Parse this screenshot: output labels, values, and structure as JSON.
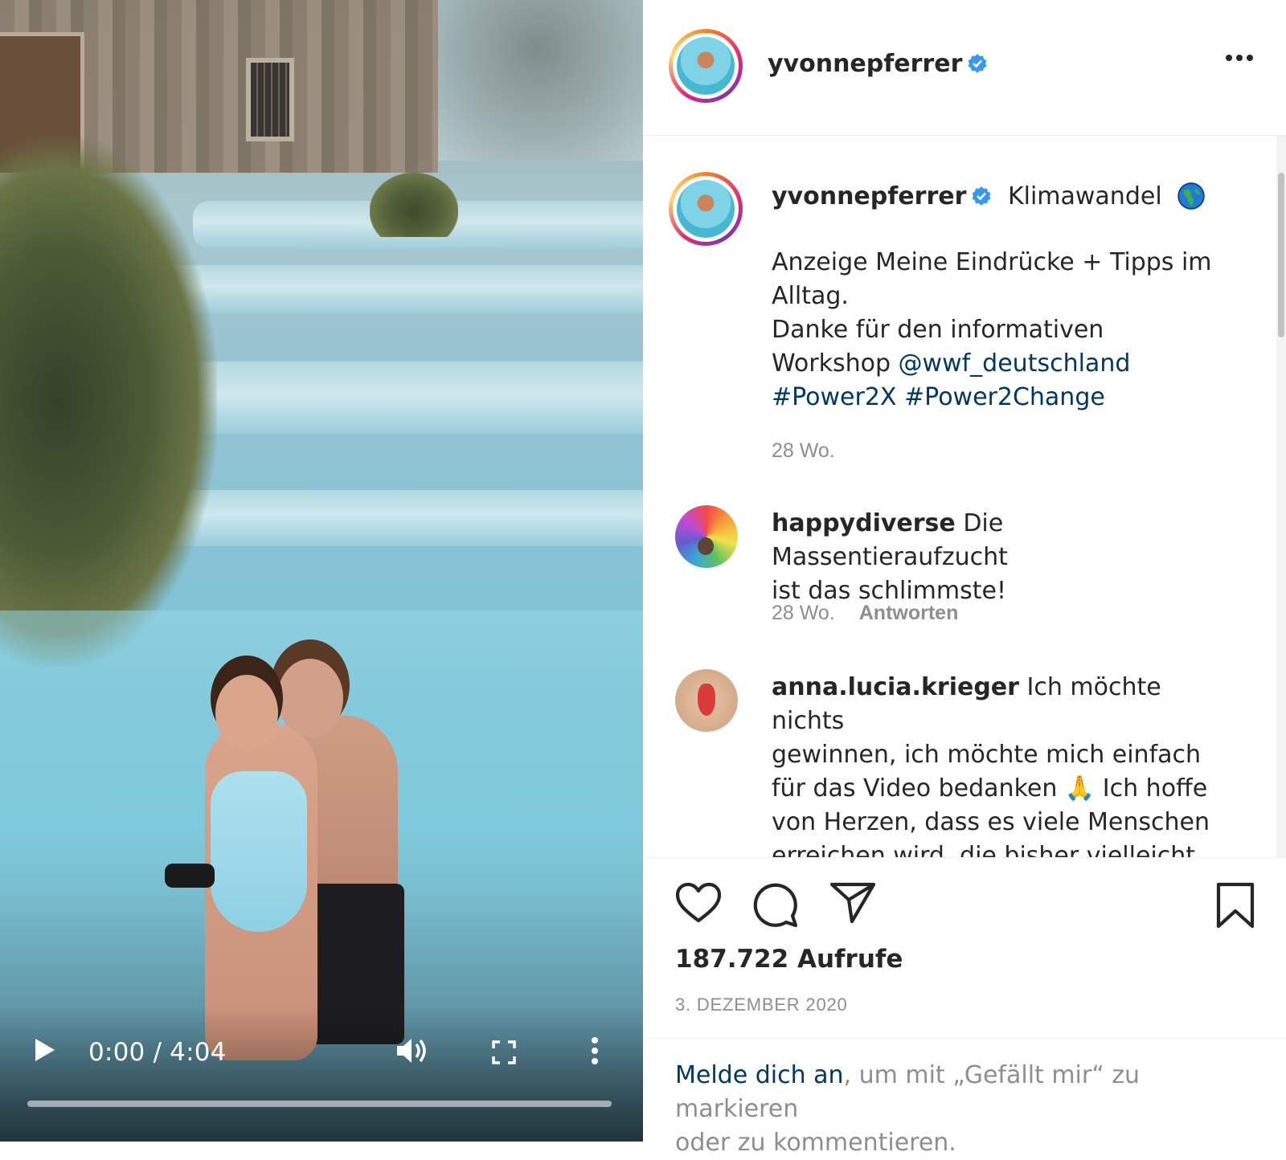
{
  "video": {
    "time_label": "0:00 / 4:04",
    "progress": 0
  },
  "header": {
    "username": "yvonnepferrer"
  },
  "caption": {
    "username": "yvonnepferrer",
    "title": "Klimawandel",
    "line1": "Anzeige Meine Eindrücke + Tipps im",
    "line2": "Alltag.",
    "line3": "Danke für den informativen",
    "line4_prefix": "Workshop ",
    "mention": "@wwf_deutschland",
    "hashtag1": "#Power2X",
    "hashtag2": "#Power2Change",
    "age": "28 Wo."
  },
  "comments": [
    {
      "username": "happydiverse",
      "text_line1": "Die Massentieraufzucht",
      "text_line2": "ist das schlimmste!",
      "age": "28 Wo.",
      "reply_label": "Antworten"
    },
    {
      "username": "anna.lucia.krieger",
      "text_line1": "Ich möchte nichts",
      "text_line2": "gewinnen, ich möchte mich einfach",
      "text_line3_a": "für das Video bedanken ",
      "emoji": "🙏",
      "text_line3_b": " Ich hoffe",
      "text_line4": "von Herzen, dass es viele Menschen",
      "text_line5": "erreichen wird, die bisher vielleicht"
    }
  ],
  "stats": {
    "views": "187.722 Aufrufe",
    "date": "3. DEZEMBER 2020"
  },
  "login_prompt": {
    "link": "Melde dich an",
    "rest_line1": ", um mit „Gefällt mir“ zu markieren",
    "rest_line2": "oder zu kommentieren."
  },
  "icons": {
    "like": "heart-icon",
    "comment": "comment-icon",
    "share": "share-icon",
    "save": "bookmark-icon",
    "verified": "verified-badge-icon",
    "globe": "globe-icon"
  },
  "colors": {
    "link": "#00376b",
    "verified": "#3897f0",
    "muted": "#8e8e8e",
    "text": "#262626"
  }
}
